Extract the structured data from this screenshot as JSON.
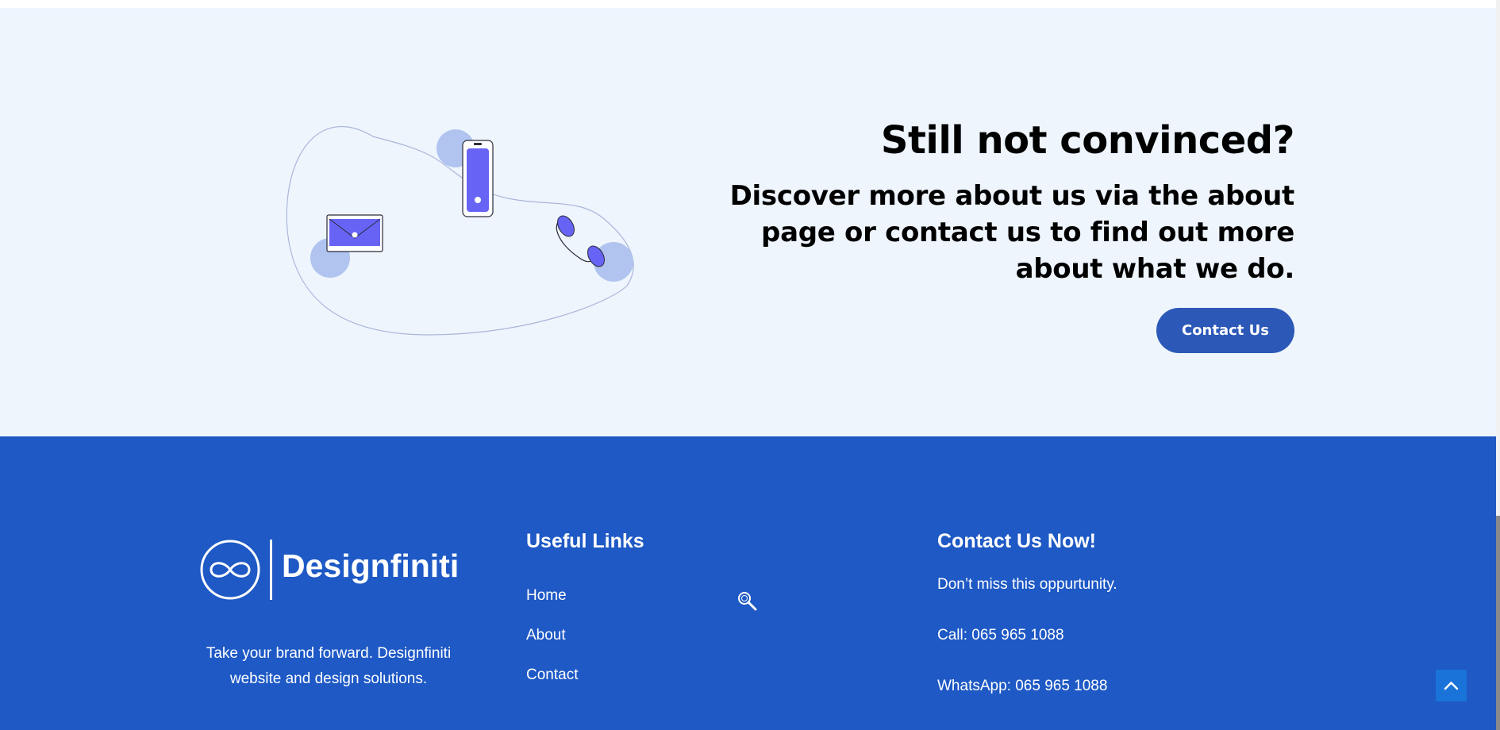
{
  "cta": {
    "title": "Still not convinced?",
    "subtitle": "Discover more about us via the about page or contact us to find out more about what we do.",
    "button_label": "Contact Us"
  },
  "footer": {
    "brand": {
      "name": "Designfiniti",
      "tagline": "Take your brand forward. Designfiniti website and design solutions."
    },
    "useful_links": {
      "heading": "Useful Links",
      "items": [
        "Home",
        "About",
        "Contact"
      ]
    },
    "contact": {
      "heading": "Contact Us Now!",
      "lines": [
        "Don’t miss this oppurtunity.",
        "Call: 065 965 1088",
        "WhatsApp: 065 965 1088"
      ]
    }
  },
  "icons": {
    "search": "search-icon",
    "back_to_top": "chevron-up-icon",
    "logo": "infinity-icon"
  },
  "colors": {
    "cta_background": "#eff5fd",
    "footer_background": "#1e59c5",
    "button": "#2c58b8",
    "illustration_accent": "#6764f5",
    "illustration_blob": "#b0c4ef",
    "back_to_top": "#1a73d9"
  }
}
